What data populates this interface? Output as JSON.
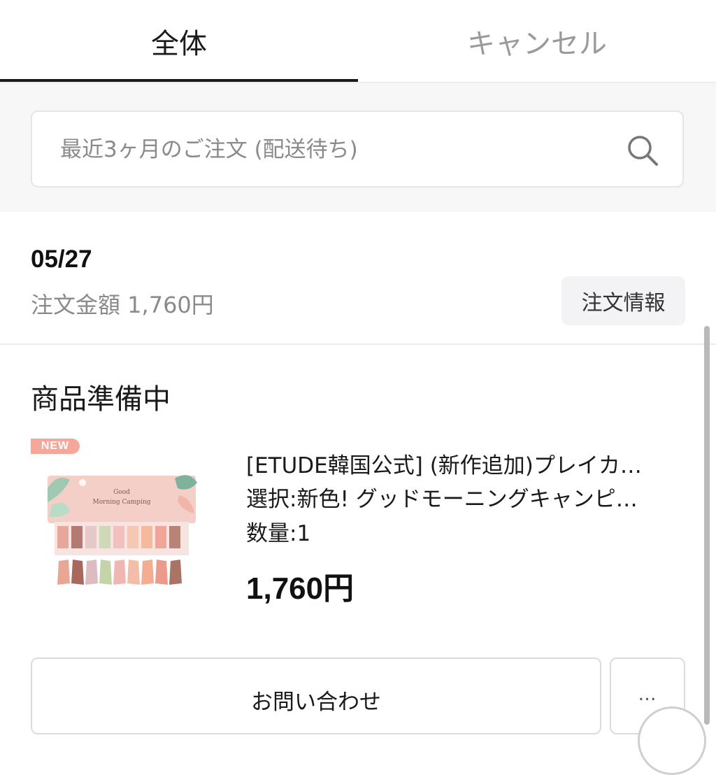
{
  "tabs": {
    "all": "全体",
    "cancel": "キャンセル"
  },
  "search": {
    "placeholder": "最近3ヶ月のご注文 (配送待ち)"
  },
  "order": {
    "date": "05/27",
    "amount_label": "注文金額 1,760円",
    "info_button": "注文情報"
  },
  "status": {
    "title": "商品準備中"
  },
  "product": {
    "badge": "NEW",
    "name": "[ETUDE韓国公式] (新作追加)プレイカ…",
    "option": "選択:新色! グッドモーニングキャンピ…",
    "quantity": "数量:1",
    "price": "1,760円",
    "image_text": "Good Morning Camping"
  },
  "actions": {
    "inquiry": "お問い合わせ",
    "more": "…"
  },
  "colors": {
    "badge": "#f5a79a",
    "active_tab": "#1a1a1a",
    "inactive_tab": "#9a9a9a"
  },
  "icons": {
    "search": "search-icon",
    "more": "ellipsis-icon"
  }
}
